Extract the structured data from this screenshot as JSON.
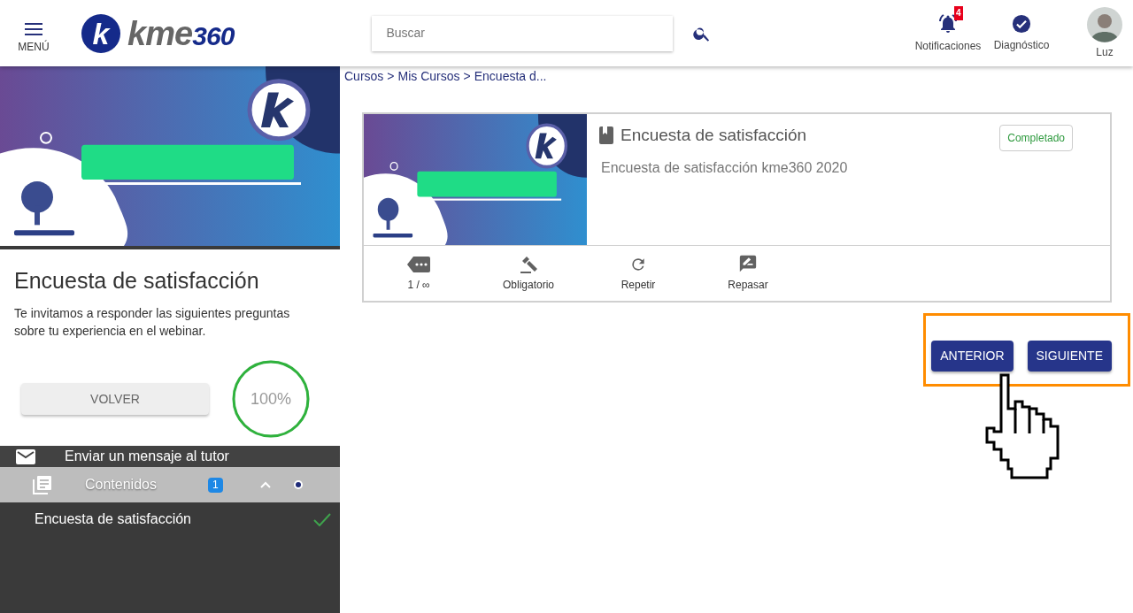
{
  "header": {
    "menu_label": "MENÚ",
    "logo": {
      "word": "kme",
      "number": "360",
      "letter": "k"
    },
    "search": {
      "placeholder": "Buscar"
    },
    "notifications": {
      "label": "Notificaciones",
      "count": "4"
    },
    "diagnostic": {
      "label": "Diagnóstico"
    },
    "user": {
      "name": "Luz"
    }
  },
  "sidebar": {
    "title": "Encuesta de satisfacción",
    "description": "Te invitamos a responder las siguientes preguntas sobre tu experiencia en el webinar.",
    "back_button": "VOLVER",
    "progress": {
      "reading": "100%",
      "level": 1
    },
    "message_link": "Enviar un mensaje al tutor",
    "contents": {
      "label": "Contenidos",
      "count": "1",
      "expanded": true,
      "items": [
        {
          "title": "Encuesta de satisfacción",
          "completed": true
        }
      ]
    }
  },
  "breadcrumb": {
    "separator": ">",
    "items": [
      "Cursos",
      "Mis Cursos",
      "Encuesta d..."
    ]
  },
  "activity": {
    "title": "Encuesta de satisfacción",
    "subtitle": "Encuesta de satisfacción kme360 2020",
    "status": "Completado",
    "actions": [
      {
        "kind": "attempts",
        "label": "1 / ∞"
      },
      {
        "kind": "mandatory",
        "label": "Obligatorio"
      },
      {
        "kind": "repeat",
        "label": "Repetir"
      },
      {
        "kind": "review",
        "label": "Repasar"
      }
    ]
  },
  "nav_buttons": [
    "ANTERIOR",
    "SIGUIENTE"
  ],
  "annotations": [
    {
      "kind": "highlight"
    },
    {
      "kind": "cursor"
    }
  ]
}
